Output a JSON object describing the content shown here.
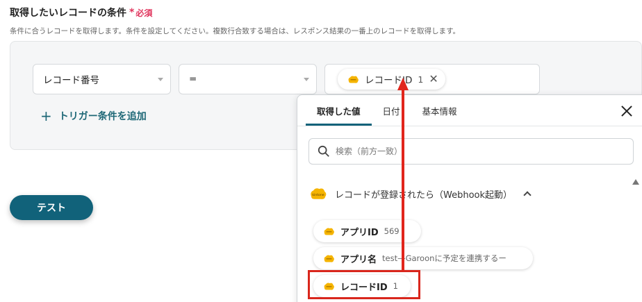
{
  "section": {
    "title": "取得したいレコードの条件",
    "required_label": "必須",
    "description": "条件に合うレコードを取得します。条件を設定してください。複数行合致する場合は、レスポンス結果の一番上のレコードを取得します。"
  },
  "condition": {
    "field": "レコード番号",
    "operator": "=",
    "value_chip": {
      "label": "レコードID",
      "value": "1"
    },
    "add_trigger_label": "トリガー条件を追加"
  },
  "test_button_label": "テスト",
  "popup": {
    "tabs": [
      {
        "label": "取得した値",
        "active": true
      },
      {
        "label": "日付",
        "active": false
      },
      {
        "label": "基本情報",
        "active": false
      }
    ],
    "search_placeholder": "検索（前方一致）",
    "group": {
      "label": "レコードが登録されたら（Webhook起動）",
      "icon_text": "kintone",
      "items": [
        {
          "label": "アプリID",
          "value": "569"
        },
        {
          "label": "アプリ名",
          "value": "test—Garoonに予定を連携するー"
        },
        {
          "label": "レコードID",
          "value": "1"
        }
      ]
    }
  },
  "colors": {
    "accent": "#11627a",
    "required": "#e0345c",
    "kintone_yellow": "#f5b400",
    "annotation_red": "#e1261c"
  }
}
